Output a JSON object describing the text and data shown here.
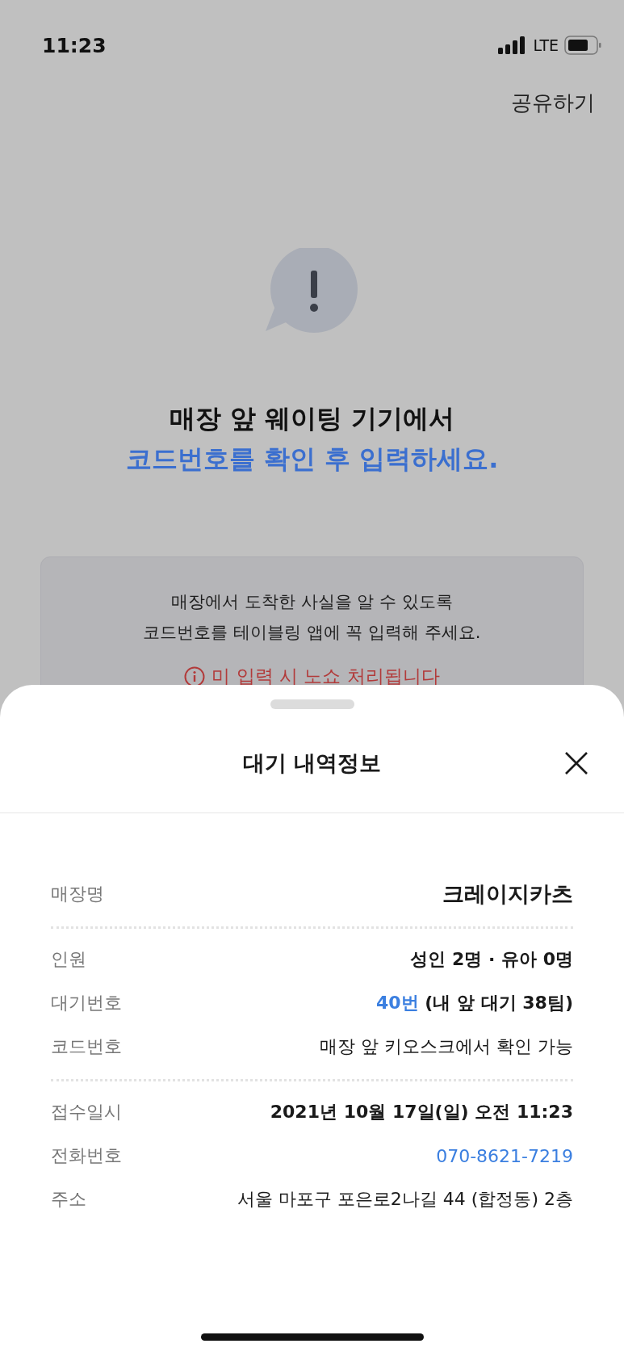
{
  "status_bar": {
    "time": "11:23",
    "network": "LTE"
  },
  "top_bar": {
    "share": "공유하기"
  },
  "heading": {
    "line_1": "매장 앞 웨이팅 기기에서",
    "line_2": "코드번호를 확인 후 입력하세요."
  },
  "notice": {
    "lines": [
      "매장에서 도착한 사실을 알 수 있도록",
      "코드번호를 테이블링 앱에 꼭 입력해 주세요."
    ],
    "warning": "미 입력 시 노쇼 처리됩니다"
  },
  "sheet": {
    "title": "대기 내역정보",
    "sections": [
      {
        "rows": [
          {
            "label": "매장명",
            "kind": "store",
            "bold": true,
            "segments": [
              {
                "text": "크레이지카츠",
                "accent": false
              }
            ]
          }
        ]
      },
      {
        "rows": [
          {
            "label": "인원",
            "kind": "normal",
            "bold": true,
            "segments": [
              {
                "text": "성인 2명 · 유아 0명",
                "accent": false
              }
            ]
          },
          {
            "label": "대기번호",
            "kind": "normal",
            "bold": true,
            "segments": [
              {
                "text": "40번",
                "accent": true
              },
              {
                "text": " (내 앞 대기 38팀)",
                "accent": false
              }
            ]
          },
          {
            "label": "코드번호",
            "kind": "normal",
            "bold": false,
            "segments": [
              {
                "text": "매장 앞 키오스크에서 확인 가능",
                "accent": false
              }
            ]
          }
        ]
      },
      {
        "rows": [
          {
            "label": "접수일시",
            "kind": "normal",
            "bold": true,
            "segments": [
              {
                "text": "2021년 10월 17일(일) 오전 11:23",
                "accent": false
              }
            ]
          },
          {
            "label": "전화번호",
            "kind": "normal",
            "bold": false,
            "segments": [
              {
                "text": "070-8621-7219",
                "accent": true
              }
            ]
          },
          {
            "label": "주소",
            "kind": "normal",
            "bold": false,
            "segments": [
              {
                "text": "서울 마포구 포은로2나길 44 (합정동) 2층",
                "accent": false
              }
            ]
          }
        ]
      }
    ]
  }
}
